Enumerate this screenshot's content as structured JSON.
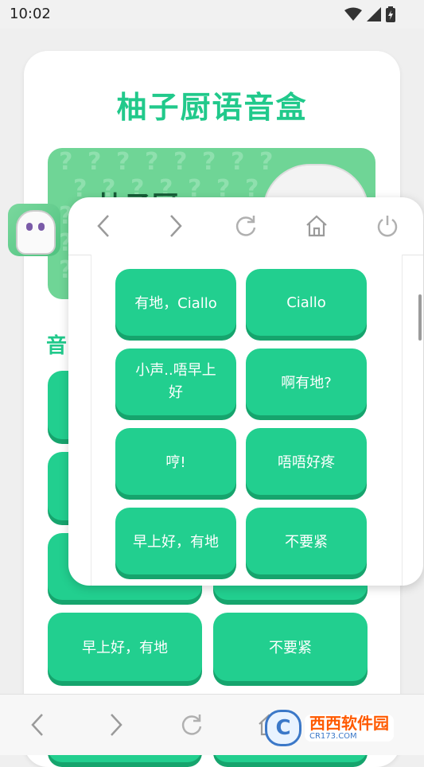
{
  "status_bar": {
    "time": "10:02",
    "icons": [
      "wifi-icon",
      "signal-icon",
      "battery-icon"
    ]
  },
  "app": {
    "title": "柚子厨语音盒",
    "banner_text": "柚子厨",
    "section_label": "音",
    "background_buttons": [
      {
        "label": "早上好，有地"
      },
      {
        "label": "不要紧"
      }
    ]
  },
  "overlay": {
    "nav_icons": [
      "back-icon",
      "forward-icon",
      "refresh-icon",
      "home-icon",
      "power-icon"
    ],
    "buttons": [
      {
        "label": "有地，Ciallo"
      },
      {
        "label": "Ciallo"
      },
      {
        "label": "小声..唔早上好"
      },
      {
        "label": "啊有地?"
      },
      {
        "label": "哼!"
      },
      {
        "label": "唔唔好疼"
      },
      {
        "label": "早上好，有地"
      },
      {
        "label": "不要紧"
      }
    ]
  },
  "bottom_bar": {
    "icons": [
      "back-icon",
      "forward-icon",
      "refresh-icon",
      "home-icon"
    ]
  },
  "watermark": {
    "main": "西西软件园",
    "sub": "CR173.COM",
    "logo_letter": "C"
  },
  "colors": {
    "accent": "#22cf8f",
    "accent_dark": "#16a46d",
    "title": "#21c98b"
  }
}
